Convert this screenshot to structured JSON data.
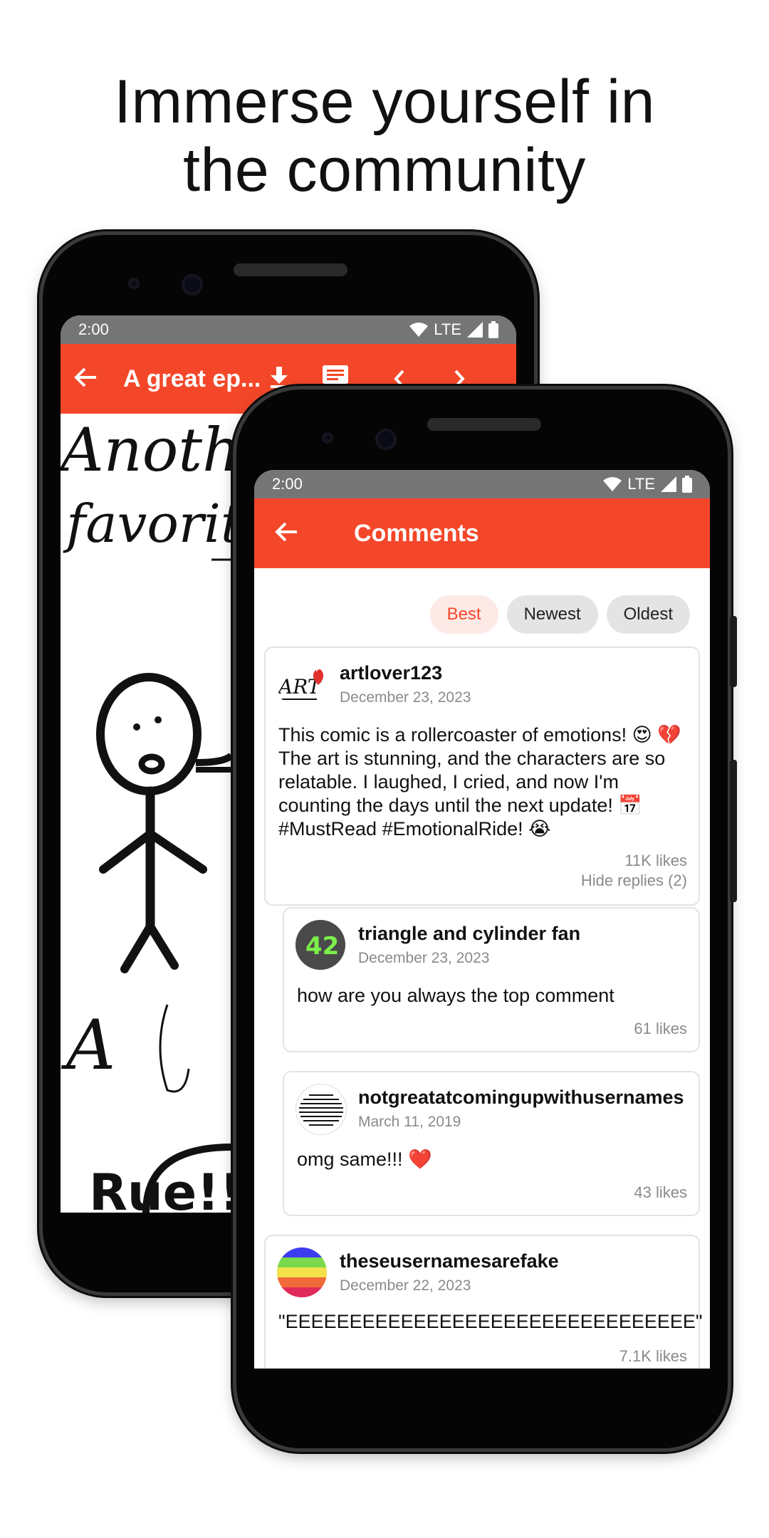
{
  "headline": {
    "line1": "Immerse yourself in",
    "line2": "the community"
  },
  "back_phone": {
    "status": {
      "time": "2:00",
      "network": "LTE"
    },
    "appbar": {
      "title": "A great ep..."
    },
    "comic_text": {
      "line1": "Another",
      "line2": "favorite",
      "line3": "A",
      "bubble": "Rue!!"
    }
  },
  "front_phone": {
    "status": {
      "time": "2:00",
      "network": "LTE"
    },
    "appbar": {
      "title": "Comments"
    },
    "sort": {
      "best": "Best",
      "newest": "Newest",
      "oldest": "Oldest",
      "active": "Best"
    },
    "comments": [
      {
        "user": "artlover123",
        "date": "December 23, 2023",
        "text": "This comic is a rollercoaster of emotions! 😍 💔 The art is stunning, and the characters are so relatable. I laughed, I cried, and now I'm counting the days until the next update! 📅 #MustRead #EmotionalRide! 😭",
        "likes": "11K likes",
        "replies_toggle": "Hide replies (2)"
      },
      {
        "user": "triangle and cylinder fan",
        "date": "December 23, 2023",
        "text": "how are you always the top comment",
        "likes": "61 likes"
      },
      {
        "user": "notgreatatcomingupwithusernames",
        "date": "March 11, 2019",
        "text": "omg same!!! ❤️",
        "likes": "43 likes"
      },
      {
        "user": "theseusernamesarefake",
        "date": "December 22, 2023",
        "text": "\"EEEEEEEEEEEEEEEEEEEEEEEEEEEEEEEE\"",
        "likes": "7.1K likes"
      }
    ]
  },
  "colors": {
    "accent": "#f4472a",
    "statusbar": "#757575",
    "chip": "#e4e4e4",
    "chip_active_bg": "#fdeae6"
  },
  "icons": [
    "back-arrow-icon",
    "download-icon",
    "comments-icon",
    "chevron-left-icon",
    "chevron-right-icon",
    "wifi-icon",
    "signal-icon",
    "battery-icon"
  ]
}
